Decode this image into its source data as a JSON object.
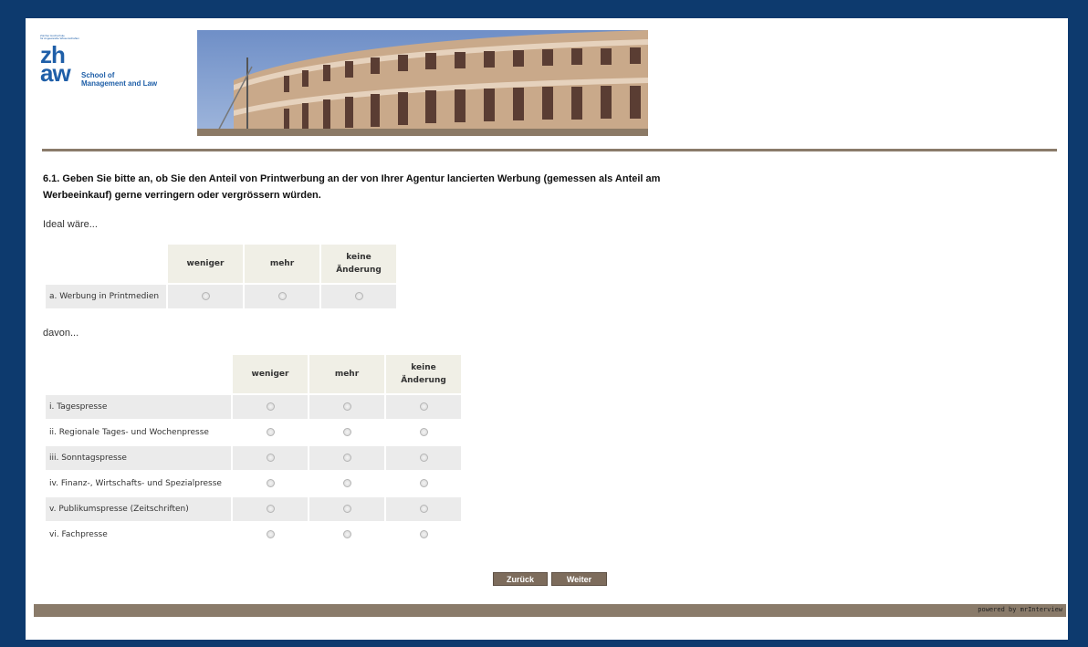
{
  "logo": {
    "tiny_text": "Zürcher Hochschule\nfür Angewandte Wissenschaften",
    "zh": "zh",
    "aw": "aw",
    "line1": "School of",
    "line2": "Management and Law"
  },
  "question": "6.1. Geben Sie bitte an, ob Sie den Anteil von Printwerbung an der von Ihrer Agentur lancierten Werbung (gemessen als Anteil am Werbeeinkauf) gerne verringern oder vergrössern würden.",
  "section1": {
    "subtitle": "Ideal wäre...",
    "columns": [
      "weniger",
      "mehr",
      "keine Änderung"
    ],
    "rows": [
      "a. Werbung in Printmedien"
    ]
  },
  "section2": {
    "subtitle": "davon...",
    "columns": [
      "weniger",
      "mehr",
      "keine Änderung"
    ],
    "rows": [
      "i. Tagespresse",
      "ii. Regionale Tages- und Wochenpresse",
      "iii. Sonntagspresse",
      "iv. Finanz-, Wirtschafts- und Spezialpresse",
      "v. Publikumspresse (Zeitschriften)",
      "vi. Fachpresse"
    ]
  },
  "buttons": {
    "back": "Zurück",
    "next": "Weiter"
  },
  "footer": "powered by mrInterview",
  "colors": {
    "frame": "#0d3a6e",
    "accent": "#8a7b6a",
    "button": "#7d6c5c",
    "logo": "#1f5fa8",
    "header_cell": "#f0efe6"
  }
}
